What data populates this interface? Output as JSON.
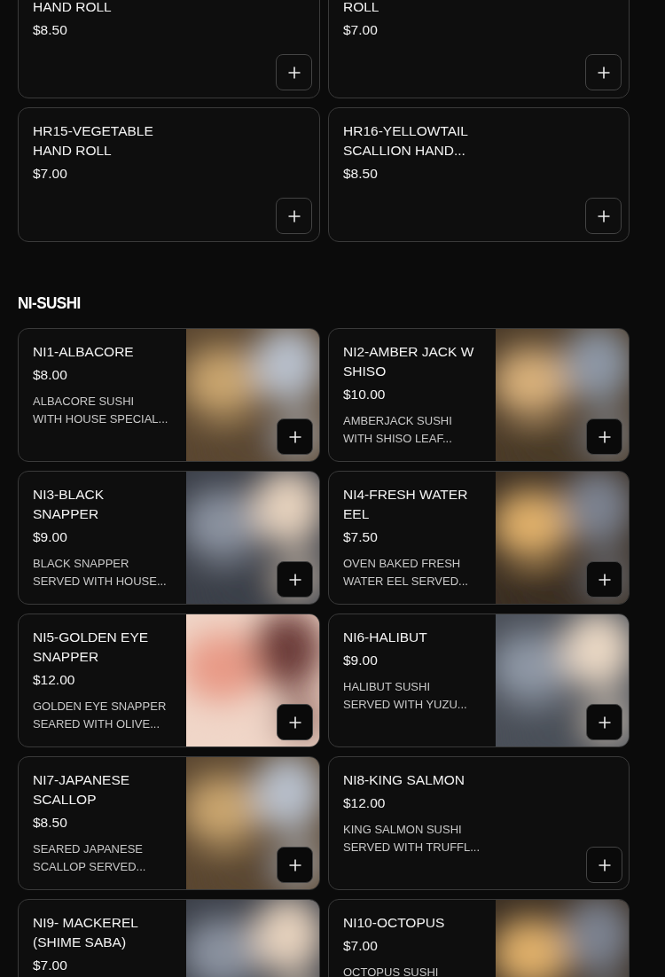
{
  "sections": [
    {
      "kind": "plain",
      "items": [
        {
          "name": "HAND ROLL",
          "price": "$8.50",
          "kind": "text"
        },
        {
          "name": "ROLL",
          "price": "$7.00",
          "kind": "text"
        },
        {
          "name": "HR15-VEGETABLE HAND ROLL",
          "price": "$7.00",
          "kind": "text"
        },
        {
          "name": "HR16-YELLOWTAIL SCALLION HAND...",
          "price": "$8.50",
          "kind": "text"
        }
      ]
    },
    {
      "title": "NI-SUSHI",
      "kind": "media",
      "items": [
        {
          "name": "NI1-ALBACORE",
          "price": "$8.00",
          "kind": "picture",
          "desc": [
            "ALBACORE SUSHI",
            "WITH HOUSE SPECIAL..."
          ]
        },
        {
          "name": "NI2-AMBER JACK W SHISO",
          "price": "$10.00",
          "kind": "picture",
          "desc": [
            "AMBERJACK SUSHI",
            "WITH SHISO LEAF..."
          ]
        },
        {
          "name": "NI3-BLACK SNAPPER",
          "price": "$9.00",
          "kind": "picture",
          "desc": [
            "BLACK SNAPPER",
            "SERVED WITH HOUSE..."
          ]
        },
        {
          "name": "NI4-FRESH WATER EEL",
          "price": "$7.50",
          "kind": "picture",
          "desc": [
            "OVEN BAKED FRESH",
            "WATER EEL SERVED..."
          ]
        },
        {
          "name": "NI5-GOLDEN EYE SNAPPER",
          "price": "$12.00",
          "kind": "picture",
          "desc": [
            "GOLDEN EYE SNAPPER",
            "SEARED WITH OLIVE..."
          ]
        },
        {
          "name": "NI6-HALIBUT",
          "price": "$9.00",
          "kind": "picture",
          "desc": [
            "HALIBUT SUSHI",
            "SERVED WITH YUZU..."
          ]
        },
        {
          "name": "NI7-JAPANESE SCALLOP",
          "price": "$8.50",
          "kind": "picture",
          "desc": [
            "SEARED JAPANESE",
            "SCALLOP SERVED..."
          ]
        },
        {
          "name": "NI8-KING SALMON",
          "price": "$12.00",
          "kind": "text",
          "desc": [
            "KING SALMON SUSHI",
            "SERVED WITH TRUFFL..."
          ]
        },
        {
          "name": "NI9- MACKEREL (SHIME SABA)",
          "price": "$7.00",
          "kind": "picture"
        },
        {
          "name": "NI10-OCTOPUS",
          "price": "$7.00",
          "kind": "picture",
          "desc": [
            "OCTOPUS SUSHI"
          ]
        }
      ]
    }
  ]
}
